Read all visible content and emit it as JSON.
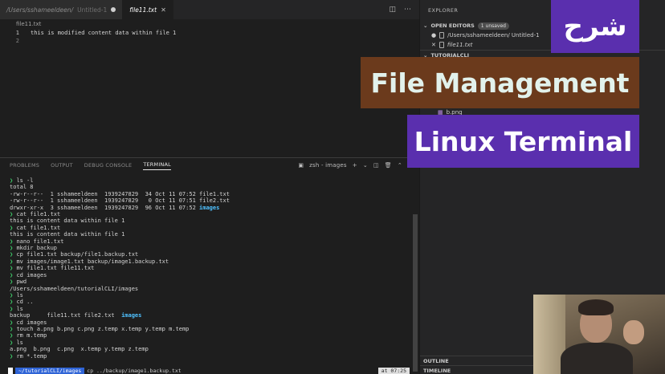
{
  "tabs": [
    {
      "path": "/Users/sshameeldeen/",
      "sub": "Untitled-1",
      "active": false,
      "dirty": true
    },
    {
      "name": "file11.txt",
      "active": true
    }
  ],
  "breadcrumb": "file11.txt",
  "editor": {
    "lines": [
      {
        "n": "1",
        "text": "this is modified content data within file 1"
      },
      {
        "n": "2",
        "text": ""
      }
    ]
  },
  "panel": {
    "tabs": [
      "PROBLEMS",
      "OUTPUT",
      "DEBUG CONSOLE",
      "TERMINAL"
    ],
    "active_tab": "TERMINAL",
    "terminal_name": "zsh - images",
    "add_label": "+"
  },
  "terminal": {
    "prompt": "❯",
    "lines": [
      {
        "kind": "cmd",
        "text": "ls -l"
      },
      {
        "kind": "out",
        "text": "total 8"
      },
      {
        "kind": "out",
        "text": "-rw-r--r--  1 sshameeldeen  1939247829  34 Oct 11 07:52 file1.txt"
      },
      {
        "kind": "out",
        "text": "-rw-r--r--  1 sshameeldeen  1939247829   0 Oct 11 07:51 file2.txt"
      },
      {
        "kind": "dir",
        "text": "drwxr-xr-x  3 sshameeldeen  1939247829  96 Oct 11 07:52 ",
        "dir": "images"
      },
      {
        "kind": "cmd",
        "text": "cat file1.txt"
      },
      {
        "kind": "out",
        "text": "this is content data within file 1"
      },
      {
        "kind": "cmd",
        "text": "cat file1.txt"
      },
      {
        "kind": "out",
        "text": "this is content data within file 1"
      },
      {
        "kind": "cmd",
        "text": "nano file1.txt"
      },
      {
        "kind": "cmd",
        "text": "mkdir backup"
      },
      {
        "kind": "cmd",
        "text": "cp file1.txt backup/file1.backup.txt"
      },
      {
        "kind": "cmd",
        "text": "mv images/image1.txt backup/image1.backup.txt"
      },
      {
        "kind": "cmd",
        "text": "mv file1.txt file11.txt"
      },
      {
        "kind": "cmd",
        "text": "cd images"
      },
      {
        "kind": "cmd",
        "text": "pwd"
      },
      {
        "kind": "out",
        "text": "/Users/sshameeldeen/tutorialCLI/images"
      },
      {
        "kind": "cmd",
        "text": "ls"
      },
      {
        "kind": "cmd",
        "text": "cd .."
      },
      {
        "kind": "cmd",
        "text": "ls"
      },
      {
        "kind": "ls",
        "text": "backup     file11.txt file2.txt  ",
        "dir": "images"
      },
      {
        "kind": "cmd",
        "text": "cd images"
      },
      {
        "kind": "cmd",
        "text": "touch a.png b.png c.png z.temp x.temp y.temp m.temp"
      },
      {
        "kind": "cmd",
        "text": "rm m.temp"
      },
      {
        "kind": "cmd",
        "text": "ls"
      },
      {
        "kind": "out",
        "text": "a.png  b.png  c.png  x.temp y.temp z.temp"
      },
      {
        "kind": "cmd",
        "text": "rm *.temp"
      }
    ],
    "status": {
      "home": "~/tutorialCLI/images",
      "command": "cp ../backup/image1.backup.txt",
      "time": "at 07:25"
    }
  },
  "explorer": {
    "title": "EXPLORER",
    "open_editors": "OPEN EDITORS",
    "unsaved_badge": "1 unsaved",
    "open_items": [
      "/Users/sshameeldeen/  Untitled-1",
      "file11.txt"
    ],
    "folder": "TUTORIALCLI",
    "file_item": "b.png",
    "outline": "OUTLINE",
    "timeline": "TIMELINE"
  },
  "banners": {
    "arabic": "شرح",
    "line1": "File Management",
    "line2": "Linux Terminal"
  },
  "colors": {
    "banner_purple": "#5a2fae",
    "banner_brown": "#6b3a1c",
    "prompt_green": "#3fd16c",
    "dir_cyan": "#4fc1ff"
  }
}
